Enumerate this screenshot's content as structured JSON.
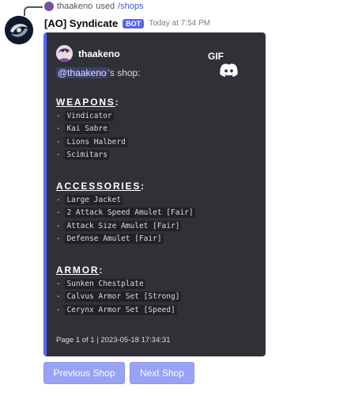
{
  "reply": {
    "username": "thaakeno",
    "used_text": "used",
    "command": "/shops"
  },
  "message": {
    "author": "[AO] Syndicate",
    "bot_tag": "BOT",
    "timestamp": "Today at 7:54 PM"
  },
  "embed": {
    "accent_color": "#5865f2",
    "author_name": "thaakeno",
    "gif_label": "GIF",
    "mention": "@thaakeno",
    "description_suffix": "'s shop:",
    "sections": [
      {
        "title": "WEAPONS",
        "items": [
          "Vindicator",
          "Kai Sabre",
          "Lions Halberd",
          "Scimitars"
        ]
      },
      {
        "title": "ACCESSORIES",
        "items": [
          "Large Jacket",
          "2 Attack Speed Amulet [Fair]",
          "Attack Size Amulet [Fair]",
          "Defense Amulet [Fair]"
        ]
      },
      {
        "title": "ARMOR",
        "items": [
          "Sunken Chestplate",
          "Calvus Armor Set [Strong]",
          "Cerynx Armor Set [Speed]"
        ]
      }
    ],
    "footer": "Page 1 of 1 | 2023-05-18 17:34:31"
  },
  "buttons": {
    "previous": "Previous Shop",
    "next": "Next Shop"
  },
  "icons": {
    "discord_logo": "discord-logo-icon",
    "bot_avatar": "syndicate-logo-icon"
  }
}
